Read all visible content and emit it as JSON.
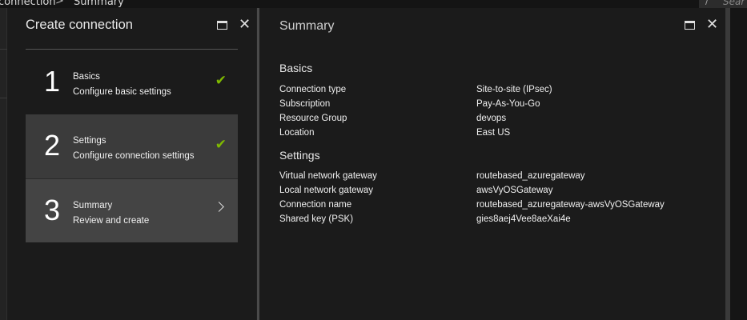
{
  "breadcrumb": {
    "items": [
      "connection",
      "Summary"
    ],
    "separator": ">"
  },
  "search": {
    "placeholder": "Sear"
  },
  "wizard": {
    "title": "Create connection",
    "steps": [
      {
        "number": "1",
        "name": "Basics",
        "description": "Configure basic settings",
        "status": "complete",
        "icon": "check-icon"
      },
      {
        "number": "2",
        "name": "Settings",
        "description": "Configure connection settings",
        "status": "complete",
        "icon": "check-icon"
      },
      {
        "number": "3",
        "name": "Summary",
        "description": "Review and create",
        "status": "current",
        "icon": "chevron-right-icon"
      }
    ]
  },
  "summary": {
    "title": "Summary",
    "basics": {
      "heading": "Basics",
      "rows": [
        {
          "label": "Connection type",
          "value": "Site-to-site (IPsec)"
        },
        {
          "label": "Subscription",
          "value": "Pay-As-You-Go"
        },
        {
          "label": "Resource Group",
          "value": "devops"
        },
        {
          "label": "Location",
          "value": "East US"
        }
      ]
    },
    "settings": {
      "heading": "Settings",
      "rows": [
        {
          "label": "Virtual network gateway",
          "value": "routebased_azuregateway"
        },
        {
          "label": "Local network gateway",
          "value": "awsVyOSGateway"
        },
        {
          "label": "Connection name",
          "value": "routebased_azuregateway-awsVyOSGateway"
        },
        {
          "label": "Shared key (PSK)",
          "value": "gies8aej4Vee8aeXai4e"
        }
      ]
    }
  },
  "icons": {
    "check": "✔",
    "close": "✕"
  },
  "colors": {
    "check": "#7fba00",
    "background": "#1b1b1b",
    "selected_step": "#444444"
  }
}
